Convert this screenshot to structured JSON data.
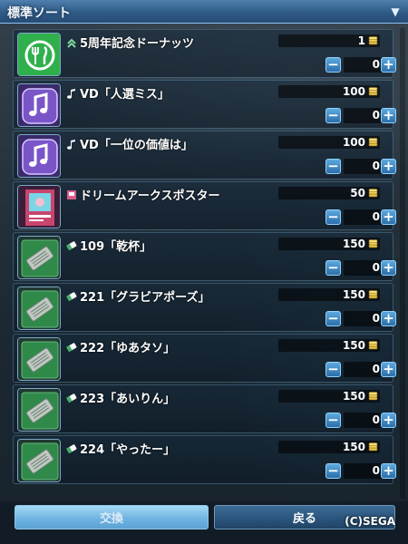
{
  "window": {
    "title": "標準ソート",
    "collapse_icon": "chevron-down-icon"
  },
  "items": [
    {
      "name": "5周年記念ドーナッツ",
      "price": "1",
      "qty": "0",
      "category_icon": "rank-up-icon",
      "thumb": "food",
      "thumb_color": "#2fb04d"
    },
    {
      "name": "VD「人選ミス」",
      "price": "100",
      "qty": "0",
      "category_icon": "music-note-icon",
      "thumb": "music",
      "thumb_color": "#7a55c8"
    },
    {
      "name": "VD「一位の価値は」",
      "price": "100",
      "qty": "0",
      "category_icon": "music-note-icon",
      "thumb": "music",
      "thumb_color": "#7a55c8"
    },
    {
      "name": "ドリームアークスポスター",
      "price": "50",
      "qty": "0",
      "category_icon": "poster-icon",
      "thumb": "poster",
      "thumb_color": "#c8456e"
    },
    {
      "name": "109「乾杯」",
      "price": "150",
      "qty": "0",
      "category_icon": "ticket-icon",
      "thumb": "ticket",
      "thumb_color": "#2f8a4a"
    },
    {
      "name": "221「グラビアポーズ」",
      "price": "150",
      "qty": "0",
      "category_icon": "ticket-icon",
      "thumb": "ticket",
      "thumb_color": "#2f8a4a"
    },
    {
      "name": "222「ゆあタソ」",
      "price": "150",
      "qty": "0",
      "category_icon": "ticket-icon",
      "thumb": "ticket",
      "thumb_color": "#2f8a4a"
    },
    {
      "name": "223「あいりん」",
      "price": "150",
      "qty": "0",
      "category_icon": "ticket-icon",
      "thumb": "ticket",
      "thumb_color": "#2f8a4a"
    },
    {
      "name": "224「やったー」",
      "price": "150",
      "qty": "0",
      "category_icon": "ticket-icon",
      "thumb": "ticket",
      "thumb_color": "#2f8a4a"
    }
  ],
  "controls": {
    "minus_symbol": "−",
    "plus_symbol": "+",
    "currency_icon": "coin-stack-icon"
  },
  "footer": {
    "exchange_label": "交換",
    "back_label": "戻る",
    "copyright": "(C)SEGA"
  },
  "colors": {
    "accent": "#4f7fae",
    "button_active": "#6fb4e2",
    "coin": "#e6c24a"
  }
}
